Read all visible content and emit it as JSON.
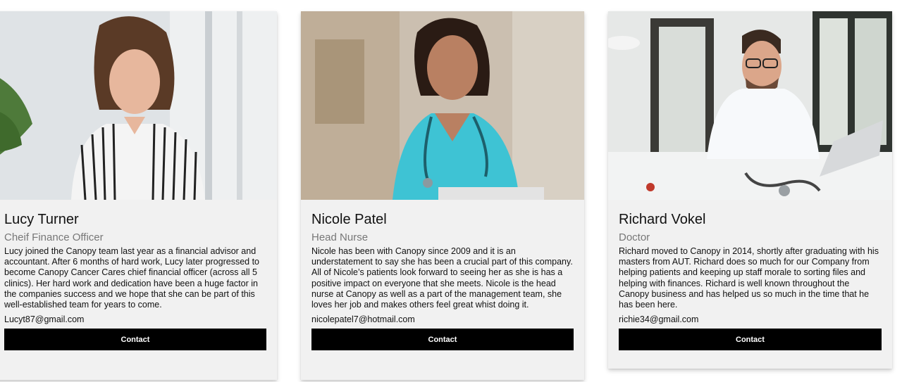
{
  "members": [
    {
      "name": "Lucy Turner",
      "role": "Cheif Finance Officer",
      "bio": "Lucy joined the Canopy team last year as a financial advisor and accountant. After 6 months of hard work, Lucy later progressed to become Canopy Cancer Cares chief financial officer (across all 5 clinics). Her hard work and dedication have been a huge factor in the companies success and we hope that she can be part of this well-established team for years to come.",
      "email": "Lucyt87@gmail.com",
      "contact_label": "Contact",
      "photo": "woman-in-striped-blouse-photo"
    },
    {
      "name": "Nicole Patel",
      "role": "Head Nurse",
      "bio": "Nicole has been with Canopy since 2009 and it is an understatement to say she has been a crucial part of this company. All of Nicole’s patients look forward to seeing her as she is has a positive impact on everyone that she meets. Nicole is the head nurse at Canopy as well as a part of the management team, she loves her job and makes others feel great whist doing it.",
      "email": "nicolepatel7@hotmail.com",
      "contact_label": "Contact",
      "photo": "nurse-with-stethoscope-photo"
    },
    {
      "name": "Richard Vokel",
      "role": "Doctor",
      "bio": "Richard moved to Canopy in 2014, shortly after graduating with his masters from AUT. Richard does so much for our Company from helping patients and keeping up staff morale to sorting files and helping with finances. Richard is well known throughout the Canopy business and has helped us so much in the time that he has been here.",
      "email": "richie34@gmail.com",
      "contact_label": "Contact",
      "photo": "doctor-at-desk-photo"
    }
  ],
  "colors": {
    "card_bg": "#f1f1f1",
    "button_bg": "#000000",
    "button_text": "#ffffff",
    "role_text": "#777777"
  }
}
